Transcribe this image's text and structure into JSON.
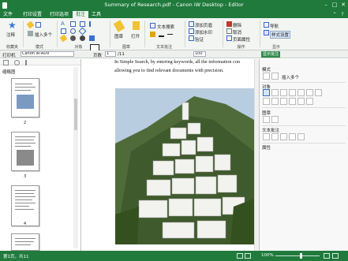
{
  "window": {
    "title": "Summary of Research.pdf - Canon iW Desktop - Editor",
    "minimize": "–",
    "maximize": "□",
    "close": "✕"
  },
  "tabs": [
    {
      "label": "文件",
      "active": false
    },
    {
      "label": "打印设置",
      "active": false
    },
    {
      "label": "打印选项",
      "active": false
    },
    {
      "label": "批注",
      "active": true
    },
    {
      "label": "工具",
      "active": false
    }
  ],
  "ribbon": {
    "annotate_label": "注释",
    "insert_multiple": "插入多个",
    "groups": {
      "favorites": "收藏夹",
      "mode": "模式",
      "objects": "对象",
      "text_annot": "文本批注",
      "stamp": "图章",
      "operation": "操作",
      "display": "显示"
    },
    "stamp_btn": "图章",
    "open_btn": "打开",
    "text_search": "文本搜索",
    "add_header_footer": "添加页眉",
    "watermark": "添加水印",
    "certify": "验证",
    "delete": "删除",
    "cancel": "取消",
    "page_properties": "页面属性",
    "navigate": "导航",
    "style_settings": "样式设置"
  },
  "toolbar": {
    "printer_label": "打印机",
    "printer_value": "Canon iR-ADV",
    "page_label": "页数",
    "page_value": "1",
    "page_total": "/11",
    "zoom_value": "100",
    "show_annotations": "显示批注"
  },
  "left_panel": {
    "title": "缩略图",
    "thumbnails": [
      {
        "page": "2"
      },
      {
        "page": "3"
      },
      {
        "page": "4"
      }
    ]
  },
  "document": {
    "line1": "In Simple Search, by entering keywords, all the information con",
    "line2": "allowing you to find relevant documents with precision."
  },
  "right_panel": {
    "mode_label": "模式",
    "insert_multiple": "插入多个",
    "objects_label": "对象",
    "stamp_label": "图章",
    "text_annot_label": "文本批注",
    "properties_label": "属性"
  },
  "status": {
    "left": "第1页，共11",
    "zoom": "100%"
  }
}
